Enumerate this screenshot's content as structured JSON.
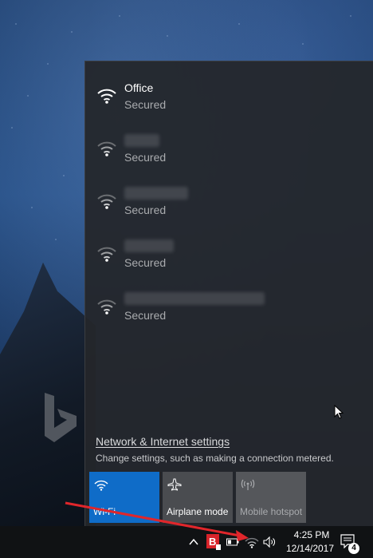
{
  "networks": [
    {
      "name": "Office",
      "status": "Secured",
      "connected": true
    },
    {
      "name": "",
      "status": "Secured",
      "connected": false
    },
    {
      "name": "",
      "status": "Secured",
      "connected": false
    },
    {
      "name": "",
      "status": "Secured",
      "connected": false
    },
    {
      "name": "",
      "status": "Secured",
      "connected": false
    }
  ],
  "settings": {
    "link": "Network & Internet settings",
    "description": "Change settings, such as making a connection metered."
  },
  "tiles": [
    {
      "label": "Wi-Fi",
      "state": "on",
      "icon": "wifi-icon"
    },
    {
      "label": "Airplane mode",
      "state": "off",
      "icon": "airplane-icon"
    },
    {
      "label": "Mobile hotspot",
      "state": "disabled",
      "icon": "hotspot-icon"
    }
  ],
  "taskbar": {
    "time": "4:25 PM",
    "date": "12/14/2017",
    "notification_count": "4",
    "tray_icons": [
      "chevron-up-icon",
      "antivirus-icon",
      "battery-icon",
      "network-icon",
      "volume-icon"
    ]
  },
  "colors": {
    "accent": "#0f6cc8",
    "flyout_bg": "#24262a",
    "annotation_arrow": "#e0262b"
  }
}
